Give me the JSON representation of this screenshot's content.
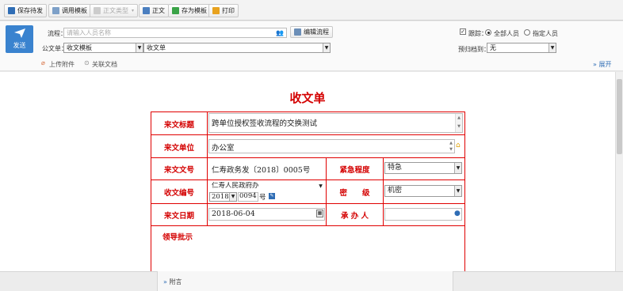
{
  "toolbar": {
    "save_draft": "保存待发",
    "use_template": "调用模板",
    "doc_type": "正文类型",
    "main_text": "正文",
    "save_as_template": "存为模板",
    "print": "打印"
  },
  "header": {
    "send_label": "发送",
    "flow_label": "流程：",
    "flow_placeholder": "请输入人员名称",
    "edit_flow": "编辑流程",
    "doc_label": "公文单：",
    "doc_select": "收文模板",
    "doc_select2": "收文单",
    "track_label": "跟踪：",
    "all_people": "全部人员",
    "specified_people": "指定人员",
    "archive_label": "预归档到：",
    "archive_value": "无",
    "upload": "上传附件",
    "related_docs": "关联文档",
    "expand": "展开"
  },
  "form": {
    "title": "收文单",
    "rows": {
      "source_title_label": "来文标题",
      "source_title_value": "跨单位授权签收流程的交换测试",
      "source_unit_label": "来文单位",
      "source_unit_value": "办公室",
      "source_no_label": "来文文号",
      "source_no_value": "仁寿政务发〔2018〕0005号",
      "urgency_label": "紧急程度",
      "urgency_value": "特急",
      "receive_no_label": "收文编号",
      "receive_org": "仁寿人民政府办",
      "receive_year": "2018",
      "receive_seq": "0094",
      "receive_suffix": "号",
      "secret_label": "密　　级",
      "secret_value": "机密",
      "date_label": "来文日期",
      "date_value": "2018-06-04",
      "handler_label": "承 办 人",
      "handler_value": "",
      "leader_label": "领导批示"
    }
  },
  "footer": {
    "note": "附言"
  }
}
